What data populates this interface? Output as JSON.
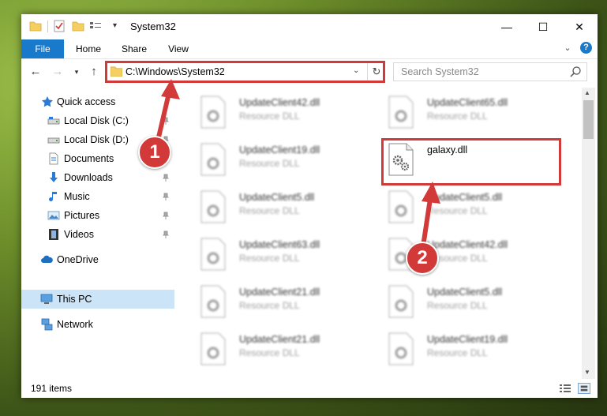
{
  "window": {
    "title": "System32",
    "controls": {
      "minimize": "—",
      "maximize": "☐",
      "close": "✕"
    }
  },
  "ribbon": {
    "tabs": [
      "File",
      "Home",
      "Share",
      "View"
    ],
    "expand_icon": "chevron-down-icon",
    "help": "?"
  },
  "address_bar": {
    "path": "C:\\Windows\\System32",
    "search_placeholder": "Search System32"
  },
  "sidebar": {
    "items": [
      {
        "label": "Quick access",
        "icon": "star-icon",
        "pinned": false
      },
      {
        "label": "Local Disk (C:)",
        "icon": "drive-icon",
        "pinned": true
      },
      {
        "label": "Local Disk (D:)",
        "icon": "drive-icon",
        "pinned": true
      },
      {
        "label": "Documents",
        "icon": "documents-icon",
        "pinned": true
      },
      {
        "label": "Downloads",
        "icon": "downloads-icon",
        "pinned": true
      },
      {
        "label": "Music",
        "icon": "music-icon",
        "pinned": true
      },
      {
        "label": "Pictures",
        "icon": "pictures-icon",
        "pinned": true
      },
      {
        "label": "Videos",
        "icon": "videos-icon",
        "pinned": true
      },
      {
        "label": "OneDrive",
        "icon": "cloud-icon",
        "pinned": false
      },
      {
        "label": "This PC",
        "icon": "computer-icon",
        "pinned": false,
        "selected": true
      },
      {
        "label": "Network",
        "icon": "network-icon",
        "pinned": false
      }
    ]
  },
  "files": {
    "left_column": [
      {
        "name": "UpdateClient42.dll",
        "type": "Resource DLL"
      },
      {
        "name": "UpdateClient19.dll",
        "type": "Resource DLL"
      },
      {
        "name": "UpdateClient5.dll",
        "type": "Resource DLL"
      },
      {
        "name": "UpdateClient63.dll",
        "type": "Resource DLL"
      },
      {
        "name": "UpdateClient21.dll",
        "type": "Resource DLL"
      },
      {
        "name": "UpdateClient21.dll",
        "type": "Resource DLL"
      }
    ],
    "right_column": [
      {
        "name": "UpdateClient65.dll",
        "type": "Resource DLL"
      },
      {
        "name": "galaxy.dll",
        "type": ""
      },
      {
        "name": "UpdateClient5.dll",
        "type": "Resource DLL"
      },
      {
        "name": "UpdateClient42.dll",
        "type": "Resource DLL"
      },
      {
        "name": "UpdateClient5.dll",
        "type": "Resource DLL"
      },
      {
        "name": "UpdateClient19.dll",
        "type": "Resource DLL"
      }
    ]
  },
  "status": {
    "item_count": "191 items"
  },
  "annotations": {
    "step1": "1",
    "step2": "2",
    "color": "#d23a3a"
  },
  "colors": {
    "accent": "#1979ca",
    "selected": "#cce4f7"
  }
}
